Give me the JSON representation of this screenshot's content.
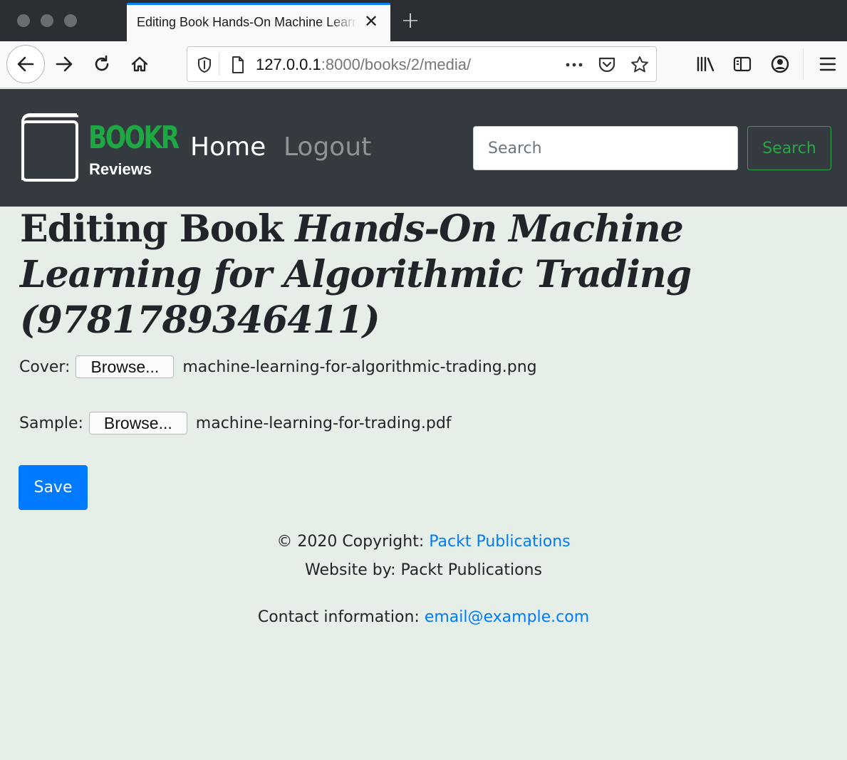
{
  "browser": {
    "tab_title": "Editing Book Hands-On Machine Learning for Algorithmic Trading",
    "url_host": "127.0.0.1",
    "url_path": ":8000/books/2/media/"
  },
  "site": {
    "logo_title": "BOOKR",
    "logo_subtitle": "Reviews",
    "nav": {
      "home": "Home",
      "logout": "Logout"
    },
    "search": {
      "placeholder": "Search",
      "button": "Search"
    }
  },
  "main": {
    "title_prefix": "Editing Book",
    "title_italic": "Hands-On Machine Learning for Algorithmic Trading (9781789346411)",
    "cover": {
      "label": "Cover:",
      "button": "Browse...",
      "filename": "machine-learning-for-algorithmic-trading.png"
    },
    "sample": {
      "label": "Sample:",
      "button": "Browse...",
      "filename": "machine-learning-for-trading.pdf"
    },
    "save": "Save"
  },
  "footer": {
    "copyright_prefix": "© 2020 Copyright:",
    "copyright_link": "Packt Publications",
    "website_by": "Website by: Packt Publications",
    "contact_prefix": "Contact information:",
    "contact_link": "email@example.com"
  },
  "colors": {
    "accent_blue": "#007bff",
    "brand_green": "#28a745",
    "header_dark": "#343a40",
    "page_bg": "#e6efe7"
  }
}
